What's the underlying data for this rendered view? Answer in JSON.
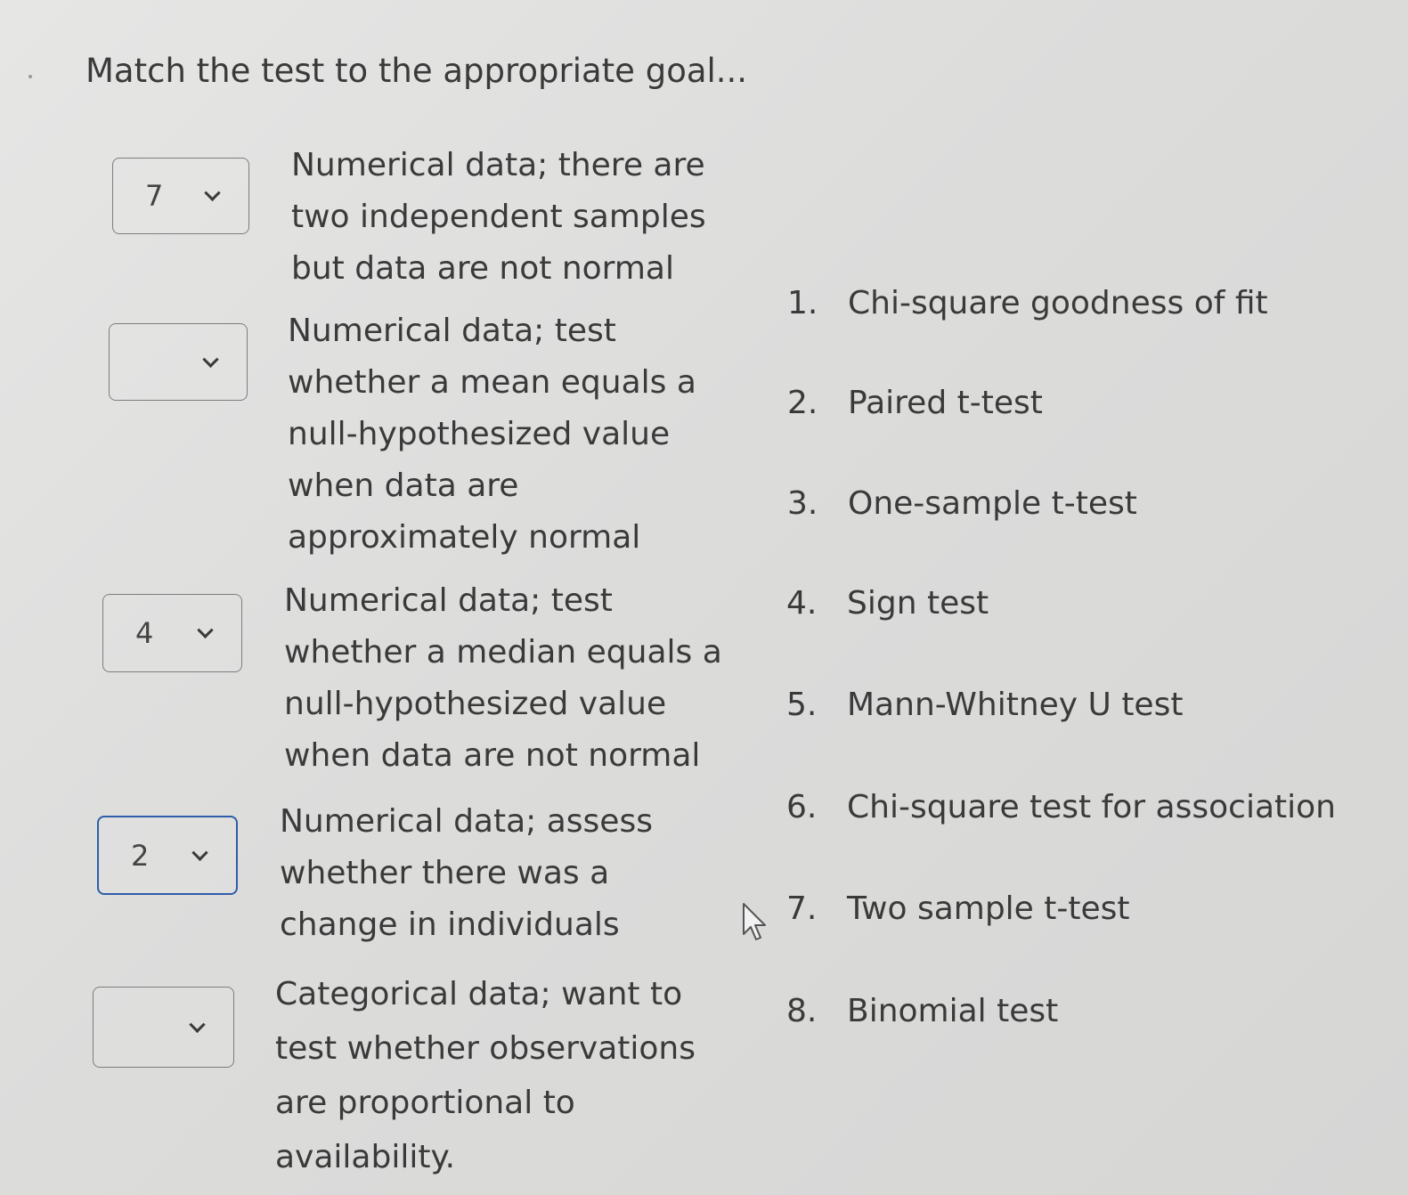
{
  "question": {
    "title": "Match the test to the appropriate goal..."
  },
  "prompts": [
    {
      "selected": "7",
      "lines": [
        "Numerical data; there are",
        "two independent samples",
        "but data are not normal"
      ]
    },
    {
      "selected": "",
      "lines": [
        "Numerical data; test",
        "whether a mean equals a",
        "null-hypothesized value",
        "when data are",
        "approximately normal"
      ]
    },
    {
      "selected": "4",
      "lines": [
        "Numerical data; test",
        "whether a median equals a",
        "null-hypothesized value",
        "when data are not normal"
      ]
    },
    {
      "selected": "2",
      "lines": [
        "Numerical data; assess",
        "whether there was a",
        "change in individuals"
      ]
    },
    {
      "selected": "",
      "lines": [
        "Categorical data; want to",
        "test whether observations",
        "are proportional to",
        "availability."
      ]
    }
  ],
  "answers": [
    {
      "num": "1.",
      "label": "Chi-square goodness of fit"
    },
    {
      "num": "2.",
      "label": "Paired t-test"
    },
    {
      "num": "3.",
      "label": "One-sample t-test"
    },
    {
      "num": "4.",
      "label": "Sign test"
    },
    {
      "num": "5.",
      "label": "Mann-Whitney U test"
    },
    {
      "num": "6.",
      "label": "Chi-square test for association"
    },
    {
      "num": "7.",
      "label": "Two sample t-test"
    },
    {
      "num": "8.",
      "label": "Binomial test"
    }
  ],
  "colors": {
    "focus_border": "#2f5da8",
    "text": "#3a3a3a"
  }
}
